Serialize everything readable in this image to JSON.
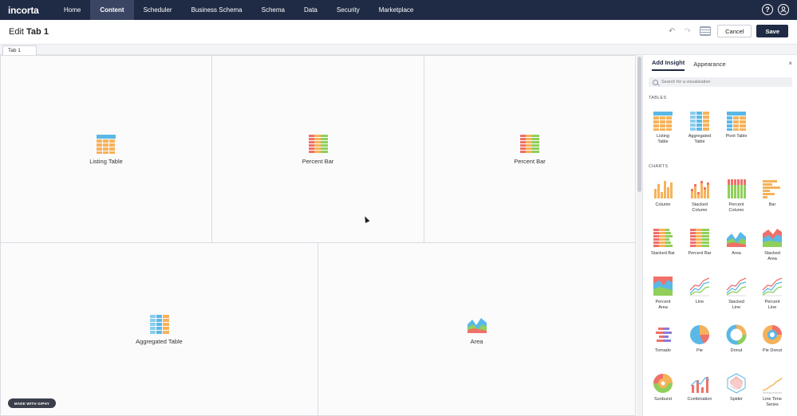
{
  "nav": {
    "logo": "incorta",
    "items": [
      {
        "label": "Home",
        "active": false
      },
      {
        "label": "Content",
        "active": true
      },
      {
        "label": "Scheduler",
        "active": false
      },
      {
        "label": "Business Schema",
        "active": false
      },
      {
        "label": "Schema",
        "active": false
      },
      {
        "label": "Data",
        "active": false
      },
      {
        "label": "Security",
        "active": false
      },
      {
        "label": "Marketplace",
        "active": false
      }
    ],
    "help_glyph": "?",
    "icons": [
      "help-icon",
      "user-icon"
    ]
  },
  "header": {
    "title_prefix": "Edit",
    "title_name": "Tab 1",
    "undo_glyph": "↶",
    "redo_glyph": "↷",
    "cancel_label": "Cancel",
    "save_label": "Save"
  },
  "tabs": [
    {
      "label": "Tab 1"
    }
  ],
  "canvas": {
    "cells": [
      {
        "label": "Listing Table",
        "icon": "listing-table"
      },
      {
        "label": "Percent Bar",
        "icon": "percent-bar"
      },
      {
        "label": "Percent Bar",
        "icon": "percent-bar"
      },
      {
        "label": "Aggregated Table",
        "icon": "aggregated-table"
      },
      {
        "label": "Area",
        "icon": "area"
      }
    ]
  },
  "panel": {
    "tabs": [
      {
        "label": "Add Insight",
        "active": true
      },
      {
        "label": "Appearance",
        "active": false
      }
    ],
    "close_glyph": "×",
    "search_placeholder": "Search for a visualization",
    "tables_heading": "TABLES",
    "charts_heading": "CHARTS",
    "tables": [
      {
        "label": "Listing\nTable",
        "icon": "listing-table"
      },
      {
        "label": "Aggregated\nTable",
        "icon": "aggregated-table"
      },
      {
        "label": "Pivot Table",
        "icon": "pivot-table"
      }
    ],
    "charts": [
      {
        "label": "Column",
        "icon": "column"
      },
      {
        "label": "Stacked\nColumn",
        "icon": "stacked-column"
      },
      {
        "label": "Percent\nColumn",
        "icon": "percent-column"
      },
      {
        "label": "Bar",
        "icon": "bar"
      },
      {
        "label": "Stacked Bar",
        "icon": "stacked-bar"
      },
      {
        "label": "Percent Bar",
        "icon": "percent-bar"
      },
      {
        "label": "Area",
        "icon": "area"
      },
      {
        "label": "Stacked\nArea",
        "icon": "stacked-area"
      },
      {
        "label": "Percent\nArea",
        "icon": "percent-area"
      },
      {
        "label": "Line",
        "icon": "line"
      },
      {
        "label": "Stacked\nLine",
        "icon": "stacked-line"
      },
      {
        "label": "Percent\nLine",
        "icon": "percent-line"
      },
      {
        "label": "Tornado",
        "icon": "tornado"
      },
      {
        "label": "Pie",
        "icon": "pie"
      },
      {
        "label": "Donut",
        "icon": "donut"
      },
      {
        "label": "Pie Donut",
        "icon": "pie-donut"
      },
      {
        "label": "Sunburst",
        "icon": "sunburst"
      },
      {
        "label": "Combination",
        "icon": "combination"
      },
      {
        "label": "Spider",
        "icon": "spider"
      },
      {
        "label": "Line Time\nSeries",
        "icon": "line-time-series"
      }
    ]
  },
  "badge": "MADE WITH GIPHY",
  "colors": {
    "nav_bg": "#1f2a44",
    "nav_active": "#394563",
    "orange": "#f6b25a",
    "blue": "#5bb8e6",
    "green": "#8fcf5a",
    "red": "#f0706a",
    "purple": "#8d7bd6"
  }
}
